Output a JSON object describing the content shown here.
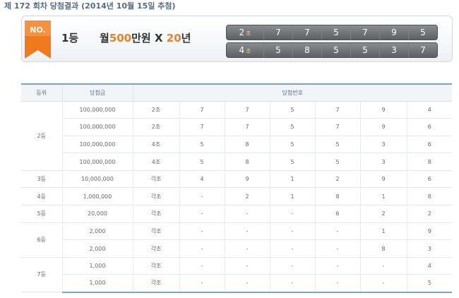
{
  "round_title": "제 172 회차 당첨결과 (2014년 10월 15일 추첨)",
  "banner": {
    "badge": "NO.",
    "rank": "1등",
    "prize_prefix": "월",
    "prize_amount": "500",
    "prize_suffix": "만원",
    "prize_x": "X",
    "prize_years": "20",
    "prize_year_unit": "년",
    "rows": [
      {
        "group": "2",
        "group_unit": "조",
        "digits": [
          "7",
          "7",
          "5",
          "7",
          "9",
          "5"
        ]
      },
      {
        "group": "4",
        "group_unit": "조",
        "digits": [
          "5",
          "8",
          "5",
          "5",
          "3",
          "7"
        ]
      }
    ]
  },
  "table": {
    "headers": [
      "등위",
      "당첨금",
      "당첨번호"
    ],
    "rows": [
      {
        "grade": "2등",
        "span": 4,
        "amount": "100,000,000",
        "group": "2조",
        "digits": [
          "7",
          "7",
          "5",
          "7",
          "9",
          "4"
        ]
      },
      {
        "amount": "100,000,000",
        "group": "2조",
        "digits": [
          "7",
          "7",
          "5",
          "7",
          "9",
          "6"
        ]
      },
      {
        "amount": "100,000,000",
        "group": "4조",
        "digits": [
          "5",
          "8",
          "5",
          "5",
          "3",
          "6"
        ]
      },
      {
        "amount": "100,000,000",
        "group": "4조",
        "digits": [
          "5",
          "8",
          "5",
          "5",
          "3",
          "8"
        ]
      },
      {
        "grade": "3등",
        "span": 1,
        "amount": "10,000,000",
        "group": "각조",
        "digits": [
          "4",
          "9",
          "1",
          "2",
          "9",
          "6"
        ]
      },
      {
        "grade": "4등",
        "span": 1,
        "amount": "1,000,000",
        "group": "각조",
        "digits": [
          "-",
          "2",
          "1",
          "8",
          "1",
          "8"
        ]
      },
      {
        "grade": "5등",
        "span": 1,
        "amount": "20,000",
        "group": "각조",
        "digits": [
          "-",
          "-",
          "-",
          "6",
          "2",
          "2"
        ]
      },
      {
        "grade": "6등",
        "span": 2,
        "amount": "2,000",
        "group": "각조",
        "digits": [
          "-",
          "-",
          "-",
          "-",
          "1",
          "9"
        ]
      },
      {
        "amount": "2,000",
        "group": "각조",
        "digits": [
          "-",
          "-",
          "-",
          "-",
          "8",
          "3"
        ]
      },
      {
        "grade": "7등",
        "span": 2,
        "amount": "1,000",
        "group": "각조",
        "digits": [
          "-",
          "-",
          "-",
          "-",
          "-",
          "4"
        ]
      },
      {
        "amount": "1,000",
        "group": "각조",
        "digits": [
          "-",
          "-",
          "-",
          "-",
          "-",
          "5"
        ]
      }
    ]
  },
  "colors": {
    "badge_orange": "#f07a1e",
    "accent_orange": "#e8832b",
    "table_border_blue": "#7fa2c6"
  }
}
